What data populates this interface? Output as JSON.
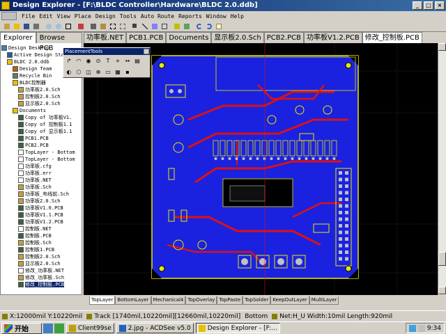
{
  "window": {
    "title": "Design Explorer - [F:\\BLDC Controller\\Hardware\\BLDC 2.0.ddb]",
    "buttons": [
      "_",
      "□",
      "×"
    ]
  },
  "menu": [
    "File",
    "Edit",
    "View",
    "Place",
    "Design",
    "Tools",
    "Auto Route",
    "Reports",
    "Window",
    "Help"
  ],
  "left_tabs": [
    "Explorer",
    "Browse PCB"
  ],
  "tree": [
    {
      "label": "Design Desktop",
      "depth": 0,
      "icon": "desktop-icon"
    },
    {
      "label": "Active Design Sta",
      "depth": 1,
      "icon": "design-station-icon"
    },
    {
      "label": "BLDC 2.0.ddb",
      "depth": 1,
      "icon": "database-icon"
    },
    {
      "label": "Design Team",
      "depth": 2,
      "icon": "team-icon"
    },
    {
      "label": "Recycle Bin",
      "depth": 2,
      "icon": "recycle-bin-icon"
    },
    {
      "label": "BLDC控制器",
      "depth": 2,
      "icon": "folder-icon"
    },
    {
      "label": "功率板2.0.Sch",
      "depth": 3,
      "icon": "schematic-icon"
    },
    {
      "label": "控制板2.0.Sch",
      "depth": 3,
      "icon": "schematic-icon"
    },
    {
      "label": "显示板2.0.Sch",
      "depth": 3,
      "icon": "schematic-icon"
    },
    {
      "label": "Documents",
      "depth": 2,
      "icon": "folder-icon"
    },
    {
      "label": "Copy of 功率板V1.",
      "depth": 3,
      "icon": "pcb-icon"
    },
    {
      "label": "Copy of 控制板1.1",
      "depth": 3,
      "icon": "pcb-icon"
    },
    {
      "label": "Copy of 显示板1.1",
      "depth": 3,
      "icon": "pcb-icon"
    },
    {
      "label": "PCB1.PCB",
      "depth": 3,
      "icon": "pcb-icon"
    },
    {
      "label": "PCB2.PCB",
      "depth": 3,
      "icon": "pcb-icon"
    },
    {
      "label": "TopLayer - Bottom",
      "depth": 3,
      "icon": "document-icon"
    },
    {
      "label": "TopLayer - Bottom",
      "depth": 3,
      "icon": "document-icon"
    },
    {
      "label": "功率板.cfg",
      "depth": 3,
      "icon": "document-icon"
    },
    {
      "label": "功率板.err",
      "depth": 3,
      "icon": "document-icon"
    },
    {
      "label": "功率板.NET",
      "depth": 3,
      "icon": "document-icon"
    },
    {
      "label": "功率板.Sch",
      "depth": 3,
      "icon": "schematic-icon"
    },
    {
      "label": "功率板_布线前.Sch",
      "depth": 3,
      "icon": "schematic-icon"
    },
    {
      "label": "功率板2.0.Sch",
      "depth": 3,
      "icon": "schematic-icon"
    },
    {
      "label": "功率板V1.0.PCB",
      "depth": 3,
      "icon": "pcb-icon"
    },
    {
      "label": "功率板V1.1.PCB",
      "depth": 3,
      "icon": "pcb-icon"
    },
    {
      "label": "功率板V1.2.PCB",
      "depth": 3,
      "icon": "pcb-icon"
    },
    {
      "label": "控制板.NET",
      "depth": 3,
      "icon": "document-icon"
    },
    {
      "label": "控制板.PCB",
      "depth": 3,
      "icon": "pcb-icon"
    },
    {
      "label": "控制板.Sch",
      "depth": 3,
      "icon": "schematic-icon"
    },
    {
      "label": "控制板1.PCB",
      "depth": 3,
      "icon": "pcb-icon"
    },
    {
      "label": "控制板2.0.Sch",
      "depth": 3,
      "icon": "schematic-icon"
    },
    {
      "label": "显示板2.0.Sch",
      "depth": 3,
      "icon": "schematic-icon"
    },
    {
      "label": "修改_功率板.NET",
      "depth": 3,
      "icon": "document-icon"
    },
    {
      "label": "修改_功率板.Sch",
      "depth": 3,
      "icon": "schematic-icon"
    },
    {
      "label": "修改_控制板.PCB",
      "depth": 3,
      "icon": "pcb-icon",
      "selected": true
    }
  ],
  "doc_tabs": [
    "功率板.NET",
    "PCB1.PCB",
    "Documents",
    "显示板2.0.Sch",
    "PCB2.PCB",
    "功率板V1.2.PCB",
    "修改_控制板.PCB"
  ],
  "active_doc_tab": 6,
  "palette": {
    "title": "PlacementTools",
    "tools": [
      "line",
      "arc",
      "via",
      "pad",
      "string",
      "coordinate",
      "dimension",
      "component",
      "fill",
      "polygon",
      "split-plane",
      "origin",
      "room",
      "array",
      "free-pad"
    ]
  },
  "layer_tabs": [
    "TopLayer",
    "BottomLayer",
    "Mechanical4",
    "TopOverlay",
    "TopPaste",
    "TopSolder",
    "KeepOutLayer",
    "MultiLayer"
  ],
  "status": {
    "coords": "X:12000mil Y:10220mil",
    "track": "Track [1740mil,10220mil][12660mil,10220mil]",
    "layer": "Bottom",
    "net": "Net:H_U Width:10mil Length:920mil"
  },
  "taskbar": {
    "start": "开始",
    "tasks": [
      "Client99se",
      "2.jpg - ACDSee v5.0",
      "Design Explorer - [F:..."
    ],
    "time": "9:34"
  },
  "colors": {
    "titlebar": "#0a246a",
    "pcb_background": "#000000",
    "bottom_layer": "#1a22e0",
    "top_layer": "#e01010",
    "overlay": "#e8e800",
    "pads": "#c0c0c0"
  }
}
